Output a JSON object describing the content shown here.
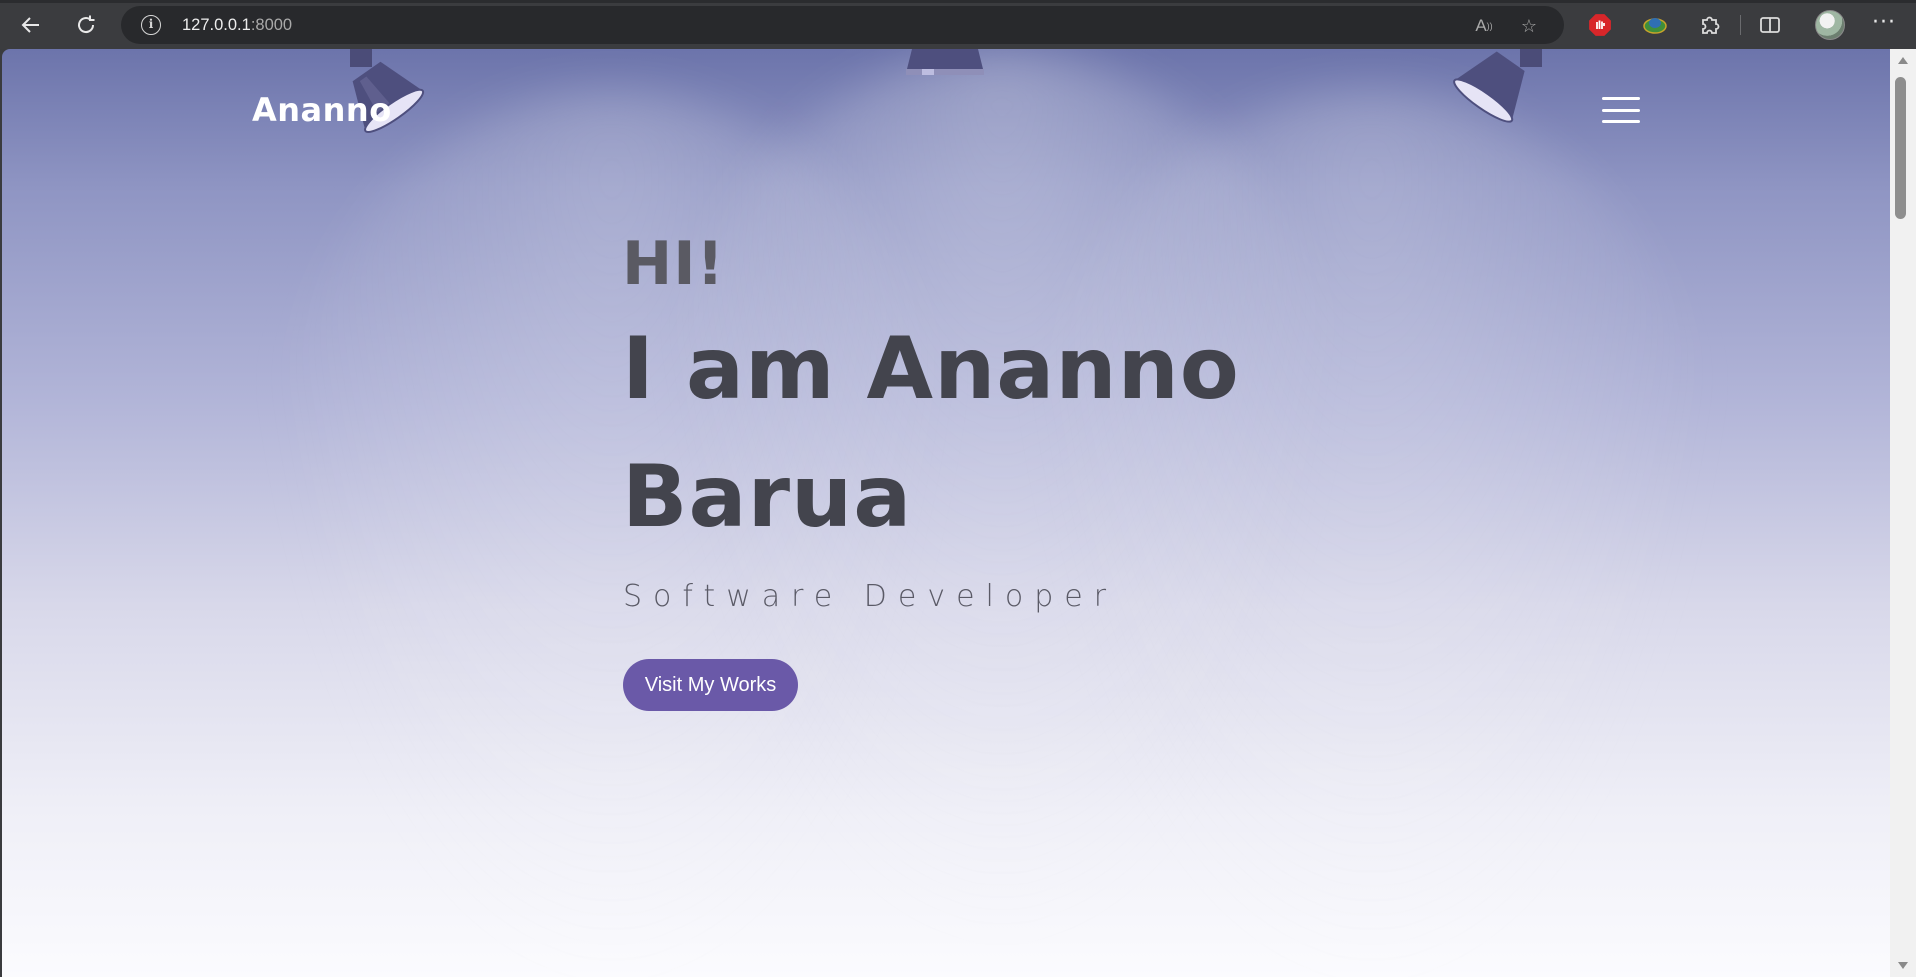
{
  "browser": {
    "url_host": "127.0.0.1",
    "url_port": ":8000",
    "icons": [
      "back-icon",
      "reload-icon",
      "site-info-icon",
      "read-aloud-icon",
      "favorite-star-icon",
      "adblock-extension-icon",
      "earth-extension-icon",
      "extensions-puzzle-icon",
      "split-screen-icon",
      "profile-avatar",
      "more-menu-icon"
    ]
  },
  "site": {
    "logo": "Ananno",
    "greeting": "HI!",
    "name_line1": "I am Ananno",
    "name_line2": "Barua",
    "role": "Software Developer",
    "cta_label": "Visit My Works"
  },
  "colors": {
    "accent": "#6a59a8",
    "heading": "#43444d",
    "background_top": "#6c74ab",
    "background_bottom": "#fbfbfe"
  }
}
